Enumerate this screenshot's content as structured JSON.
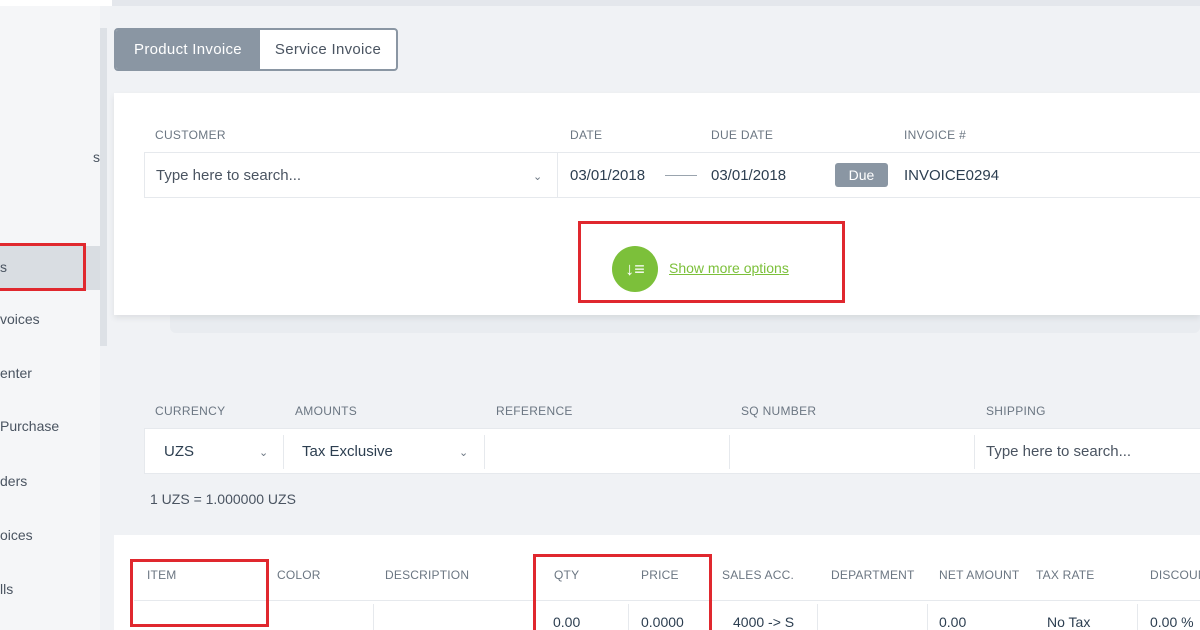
{
  "sidebar": {
    "items": [
      {
        "label": "s"
      },
      {
        "label": "s"
      },
      {
        "label": "voices"
      },
      {
        "label": "enter"
      },
      {
        "label": "Purchase"
      },
      {
        "label": "ders"
      },
      {
        "label": "oices"
      },
      {
        "label": "lls"
      }
    ]
  },
  "tabs": [
    {
      "label": "Product Invoice",
      "active": true
    },
    {
      "label": "Service Invoice",
      "active": false
    }
  ],
  "header": {
    "customer_label": "CUSTOMER",
    "customer_placeholder": "Type here to search...",
    "date_label": "DATE",
    "date_value": "03/01/2018",
    "due_date_label": "DUE DATE",
    "due_date_value": "03/01/2018",
    "due_badge": "Due",
    "invoice_label": "INVOICE #",
    "invoice_value": "INVOICE0294",
    "show_more_label": "Show more options"
  },
  "details": {
    "currency_label": "CURRENCY",
    "currency_value": "UZS",
    "amounts_label": "AMOUNTS",
    "amounts_value": "Tax Exclusive",
    "reference_label": "REFERENCE",
    "sq_number_label": "SQ NUMBER",
    "shipping_label": "SHIPPING",
    "shipping_placeholder": "Type here to search...",
    "exchange_rate": "1 UZS = 1.000000 UZS"
  },
  "table": {
    "columns": [
      "ITEM",
      "COLOR",
      "DESCRIPTION",
      "QTY",
      "PRICE",
      "SALES ACC.",
      "DEPARTMENT",
      "NET AMOUNT",
      "TAX RATE",
      "DISCOUN"
    ],
    "row": {
      "qty": "0.00",
      "price": "0.0000",
      "sales_acc": "4000 -> S",
      "net_amount": "0.00",
      "tax_rate": "No Tax",
      "discount": "0.00 %"
    }
  },
  "colors": {
    "accent_green": "#7cc03a",
    "highlight_red": "#e0282e",
    "tab_active": "#8a96a3"
  }
}
